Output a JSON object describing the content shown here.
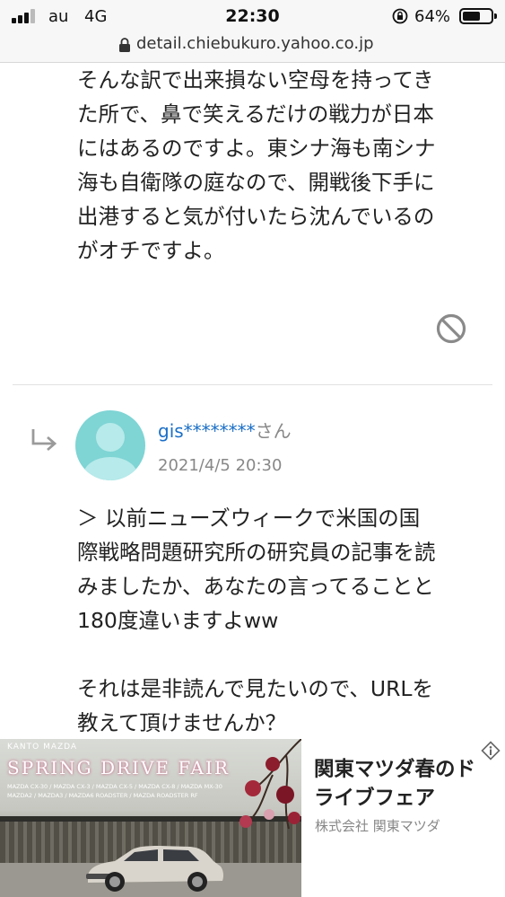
{
  "status_bar": {
    "carrier": "au",
    "network": "4G",
    "time": "22:30",
    "battery": "64%",
    "battery_level": 0.64
  },
  "browser": {
    "url": "detail.chiebukuro.yahoo.co.jp"
  },
  "previous_answer": {
    "lines": [
      "そんな訳で出来損ない空母を持ってき",
      "た所で、鼻で笑えるだけの戦力が日本",
      "にはあるのですよ。東シナ海も南シナ",
      "海も自衛隊の庭なので、開戦後下手に",
      "出港すると気が付いたら沈んでいるの",
      "がオチですよ。"
    ]
  },
  "reply": {
    "user_name": "gis********",
    "honorific": "さん",
    "date": "2021/4/5 20:30",
    "lines": [
      "＞ 以前ニューズウィークで米国の国",
      "際戦略問題研究所の研究員の記事を読",
      "みましたか、あなたの言ってることと",
      "180度違いますよww",
      "",
      "それは是非読んで見たいので、URLを",
      "教えて頂けませんか？"
    ]
  },
  "ad": {
    "image_subtitle": "KANTO MAZDA",
    "image_title": "SPRING DRIVE FAIR",
    "image_models": [
      "MAZDA CX-30 / MAZDA CX-3 / MAZDA CX-5 / MAZDA CX-8 / MAZDA MX-30",
      "MAZDA2 / MAZDA3 / MAZDA6 ROADSTER / MAZDA ROADSTER RF"
    ],
    "title": "関東マツダ春のドライブフェア",
    "sponsor": "株式会社 関東マツダ"
  },
  "colors": {
    "link": "#1a6fc7",
    "avatar": "#7fd4d4",
    "muted": "#888888"
  },
  "icons": {
    "report": "report-prohibit-icon",
    "reply": "reply-arrow-icon",
    "ad_info": "info-icon"
  }
}
